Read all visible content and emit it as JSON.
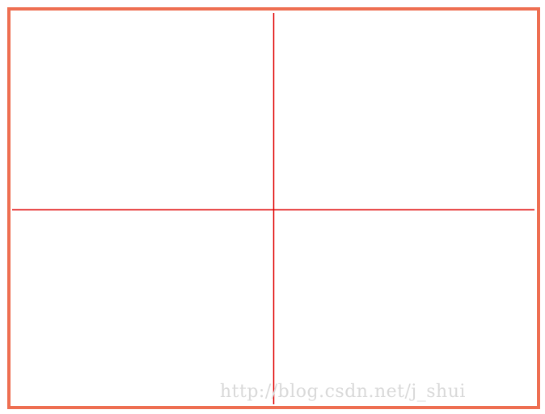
{
  "frame": {
    "border_color": "#ee6e51"
  },
  "crosshair": {
    "line_color": "#e00000"
  },
  "watermark": {
    "text": "http://blog.csdn.net/j_shui"
  }
}
